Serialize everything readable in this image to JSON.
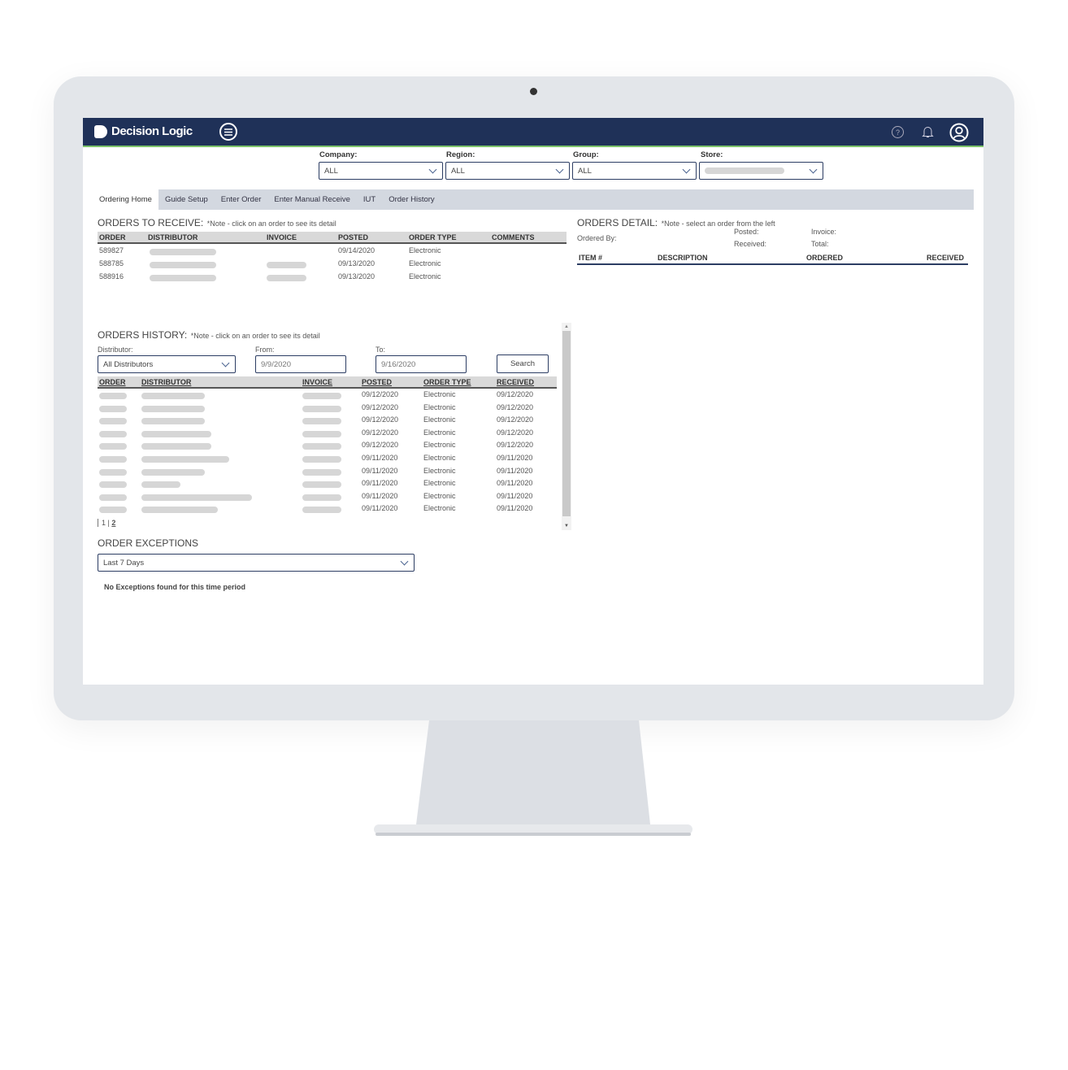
{
  "app": {
    "name": "Decision Logic",
    "accent": "#1f3158",
    "highlight": "#7cc36a"
  },
  "header": {
    "icons": [
      "menu-icon",
      "help-icon",
      "bell-icon",
      "user-icon"
    ]
  },
  "filters": [
    {
      "label": "Company:",
      "value": "ALL"
    },
    {
      "label": "Region:",
      "value": "ALL"
    },
    {
      "label": "Group:",
      "value": "ALL"
    },
    {
      "label": "Store:",
      "value": ""
    }
  ],
  "tabs": [
    "Ordering Home",
    "Guide Setup",
    "Enter Order",
    "Enter Manual Receive",
    "IUT",
    "Order History"
  ],
  "receive": {
    "title": "ORDERS TO RECEIVE:",
    "note": "*Note - click on an order to see its detail",
    "columns": [
      "ORDER",
      "DISTRIBUTOR",
      "INVOICE",
      "POSTED",
      "ORDER TYPE",
      "COMMENTS"
    ],
    "rows": [
      {
        "order": "589827",
        "posted": "09/14/2020",
        "type": "Electronic"
      },
      {
        "order": "588785",
        "posted": "09/13/2020",
        "type": "Electronic"
      },
      {
        "order": "588916",
        "posted": "09/13/2020",
        "type": "Electronic"
      }
    ]
  },
  "detail": {
    "title": "ORDERS DETAIL:",
    "note": "*Note - select an order from the left",
    "ordered_by": "Ordered By:",
    "posted": "Posted:",
    "received": "Received:",
    "invoice": "Invoice:",
    "total": "Total:",
    "columns": [
      "ITEM #",
      "DESCRIPTION",
      "ORDERED",
      "RECEIVED"
    ]
  },
  "history": {
    "title": "ORDERS HISTORY:",
    "note": "*Note - click on an order to see its detail",
    "distributor_label": "Distributor:",
    "distributor_value": "All Distributors",
    "from_label": "From:",
    "from_value": "9/9/2020",
    "to_label": "To:",
    "to_value": "9/16/2020",
    "search": "Search",
    "columns": [
      "ORDER",
      "DISTRIBUTOR",
      "INVOICE",
      "POSTED",
      "ORDER TYPE",
      "RECEIVED"
    ],
    "rows": [
      {
        "posted": "09/12/2020",
        "type": "Electronic",
        "received": "09/12/2020"
      },
      {
        "posted": "09/12/2020",
        "type": "Electronic",
        "received": "09/12/2020"
      },
      {
        "posted": "09/12/2020",
        "type": "Electronic",
        "received": "09/12/2020"
      },
      {
        "posted": "09/12/2020",
        "type": "Electronic",
        "received": "09/12/2020"
      },
      {
        "posted": "09/12/2020",
        "type": "Electronic",
        "received": "09/12/2020"
      },
      {
        "posted": "09/11/2020",
        "type": "Electronic",
        "received": "09/11/2020"
      },
      {
        "posted": "09/11/2020",
        "type": "Electronic",
        "received": "09/11/2020"
      },
      {
        "posted": "09/11/2020",
        "type": "Electronic",
        "received": "09/11/2020"
      },
      {
        "posted": "09/11/2020",
        "type": "Electronic",
        "received": "09/11/2020"
      },
      {
        "posted": "09/11/2020",
        "type": "Electronic",
        "received": "09/11/2020"
      }
    ],
    "pages": [
      "1",
      "2"
    ]
  },
  "exceptions": {
    "title": "ORDER EXCEPTIONS",
    "range": "Last 7 Days",
    "empty": "No Exceptions found for this time period"
  }
}
